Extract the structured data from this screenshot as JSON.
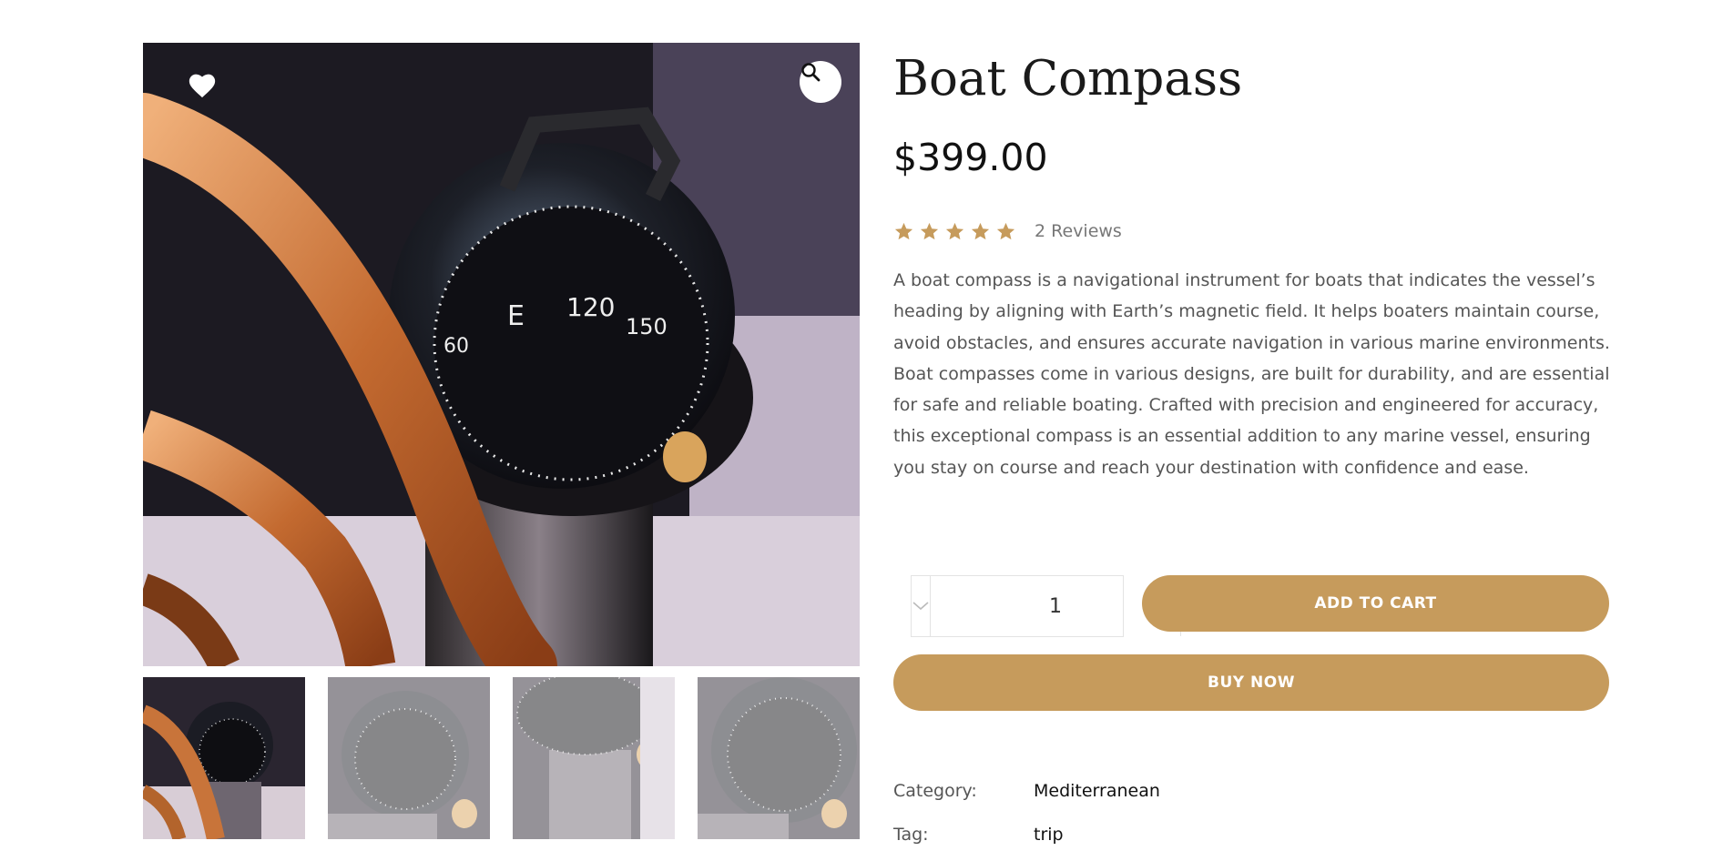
{
  "gallery": {
    "wishlist_icon": "heart-icon",
    "zoom_icon": "search-icon",
    "thumbnails": [
      {
        "name": "thumbnail-1",
        "active": true
      },
      {
        "name": "thumbnail-2",
        "active": false
      },
      {
        "name": "thumbnail-3",
        "active": false
      },
      {
        "name": "thumbnail-4",
        "active": false
      }
    ]
  },
  "product": {
    "title": "Boat Compass",
    "price": "$399.00",
    "rating": 5,
    "reviews_label": "2 Reviews",
    "description": "A boat compass is a navigational instrument for boats that indicates the vessel’s heading by aligning with Earth’s magnetic field. It helps boaters maintain course, avoid obstacles, and ensures accurate navigation in various marine environments. Boat compasses come in various designs, are built for durability, and are essential for safe and reliable boating. Crafted with precision and engineered for accuracy, this exceptional compass is an essential addition to any marine vessel, ensuring you stay on course and reach your destination with confidence and ease."
  },
  "purchase": {
    "quantity": "1",
    "add_to_cart_label": "ADD TO CART",
    "buy_now_label": "BUY NOW"
  },
  "meta": {
    "category_label": "Category:",
    "category_value": "Mediterranean",
    "tag_label": "Tag:",
    "tag_value": "trip"
  },
  "colors": {
    "accent": "#c69b5c",
    "star": "#c69b5c",
    "text_muted": "#555555"
  }
}
